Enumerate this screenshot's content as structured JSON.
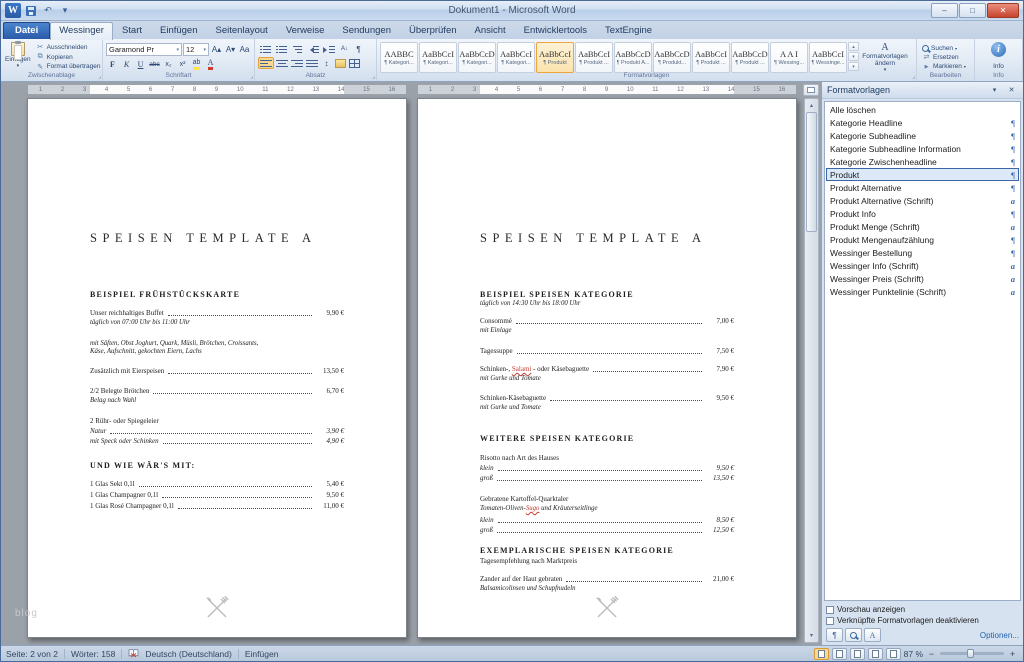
{
  "window": {
    "title": "Dokument1 - Microsoft Word"
  },
  "icons": {
    "undo": "↶",
    "caret_down": "▾",
    "caret_up": "▴",
    "minimize": "–",
    "maximize": "□",
    "close": "✕",
    "scissors": "✂",
    "copy": "⧉",
    "painter": "✎",
    "pilcrow": "¶",
    "sort": "A↓",
    "spacing": "↕",
    "grow": "A▴",
    "shrink": "A▾",
    "case": "Aa",
    "replace": "⇄",
    "select": "▶"
  },
  "tabs": {
    "file": "Datei",
    "items": [
      "Wessinger",
      "Start",
      "Einfügen",
      "Seitenlayout",
      "Verweise",
      "Sendungen",
      "Überprüfen",
      "Ansicht",
      "Entwicklertools",
      "TextEngine"
    ]
  },
  "ribbon": {
    "clipboard": {
      "group": "Zwischenablage",
      "paste": "Einfügen",
      "cut": "Ausschneiden",
      "copy": "Kopieren",
      "painter": "Format übertragen"
    },
    "font": {
      "group": "Schriftart",
      "name": "Garamond Pr",
      "size": "12",
      "bold": "F",
      "italic": "K",
      "underline": "U",
      "strike": "abc",
      "sub": "x₂",
      "sup": "x²",
      "highlight": "ab",
      "color": "A"
    },
    "paragraph": {
      "group": "Absatz"
    },
    "styles": {
      "group": "Formatvorlagen",
      "change": "Formatvorlagen ändern",
      "items": [
        {
          "preview": "AABBC",
          "name": "¶ Kategori..."
        },
        {
          "preview": "AaBbCcI",
          "name": "¶ Kategori..."
        },
        {
          "preview": "AaBbCcD",
          "name": "¶ Kategori..."
        },
        {
          "preview": "AaBbCcI",
          "name": "¶ Kategori..."
        },
        {
          "preview": "AaBbCcI",
          "name": "¶ Produkt"
        },
        {
          "preview": "AaBbCcI",
          "name": "¶ Produkt ..."
        },
        {
          "preview": "AaBbCcD",
          "name": "¶ Produkt A..."
        },
        {
          "preview": "AaBbCcD",
          "name": "¶ Produkt..."
        },
        {
          "preview": "AaBbCcI",
          "name": "¶ Produkt ..."
        },
        {
          "preview": "AaBbCcD",
          "name": "¶ Produkt ..."
        },
        {
          "preview": "A A I",
          "name": "¶ Wessing..."
        },
        {
          "preview": "AaBbCcI",
          "name": "¶ Wessinge..."
        }
      ]
    },
    "editing": {
      "group": "Bearbeiten",
      "find": "Suchen",
      "replace": "Ersetzen",
      "select": "Markieren"
    },
    "info": {
      "group": "Info",
      "label": "Info"
    }
  },
  "ruler": {
    "numbers": "1 2 3 4 5 6 7 8 9 10 11 12 13 14 15 16"
  },
  "doc": {
    "page1": {
      "title": "SPEISEN TEMPLATE A",
      "h1": "BEISPIEL FRÜHSTÜCKSKARTE",
      "i1": {
        "name": "Unser reichhaltiges Buffet",
        "price": "9,90 €",
        "sub": "täglich von 07:00 Uhr bis 11:00 Uhr"
      },
      "note1": "mit Säften, Obst Joghurt, Quark, Müsli, Brötchen, Croissants,",
      "note2": "Käse, Aufschnitt, gekochten Eiern, Lachs",
      "i2": {
        "name": "Zusätzlich mit Eierspeisen",
        "price": "13,50 €"
      },
      "i3": {
        "name": "2/2 Belegte Brötchen",
        "price": "6,70 €",
        "sub": "Belag nach Wahl"
      },
      "i4": {
        "name": "2 Rühr- oder Spiegeleier"
      },
      "i4a": {
        "name": "Natur",
        "price": "3,90 €"
      },
      "i4b": {
        "name": "mit Speck oder Schinken",
        "price": "4,90 €"
      },
      "h2": "UND WIE WÄR'S MIT:",
      "i5": {
        "name": "1 Glas Sekt  0,1l",
        "price": "5,40 €"
      },
      "i6": {
        "name": "1 Glas Champagner  0,1l",
        "price": "9,50 €"
      },
      "i7": {
        "name": "1 Glas Rosé Champagner  0,1l",
        "price": "11,00 €"
      }
    },
    "page2": {
      "title": "SPEISEN TEMPLATE A",
      "h1": "BEISPIEL SPEISEN KATEGORIE",
      "h1_sub": "täglich von 14:30 Uhr bis 18:00 Uhr",
      "i1": {
        "name": "Consommé",
        "price": "7,00 €",
        "sub": "mit Einlage"
      },
      "i2": {
        "name": "Tagessuppe",
        "price": "7,50 €"
      },
      "i3": {
        "pre": "Schinken-, ",
        "red": "Salami",
        "post": " - oder Käsebaguette",
        "price": "7,90 €",
        "sub": "mit Gurke und Tomate"
      },
      "i4": {
        "name": "Schinken-Käsebaguette",
        "price": "9,50 €",
        "sub": "mit Gurke und Tomate"
      },
      "h2": "WEITERE SPEISEN KATEGORIE",
      "i5": {
        "name": "Risotto nach Art des Hauses"
      },
      "i5a": {
        "name": "klein",
        "price": "9,50 €"
      },
      "i5b": {
        "name": "groß",
        "price": "13,50 €"
      },
      "i6": {
        "name": "Gebratene Kartoffel-Quarktaler"
      },
      "i6sub": {
        "pre": "Tomaten-Oliven-",
        "red": "Sugo",
        "post": " und Kräuterseitlinge"
      },
      "i6a": {
        "name": "klein",
        "price": "8,50 €"
      },
      "i6b": {
        "name": "groß",
        "price": "12,50 €"
      },
      "h3": "EXEMPLARISCHE SPEISEN KATEGORIE",
      "h3_sub": "Tagesempfehlung nach Marktpreis",
      "i7": {
        "name": "Zander auf der Haut gebraten",
        "price": "21,00 €",
        "sub": "Balsamicolinsen und Schupfnudeln"
      }
    }
  },
  "pane": {
    "title": "Formatvorlagen",
    "clear_all": "Alle löschen",
    "items": [
      {
        "label": "Kategorie Headline",
        "type": "¶"
      },
      {
        "label": "Kategorie Subheadline",
        "type": "¶"
      },
      {
        "label": "Kategorie Subheadline Information",
        "type": "¶"
      },
      {
        "label": "Kategorie Zwischenheadline",
        "type": "¶"
      },
      {
        "label": "Produkt",
        "type": "¶"
      },
      {
        "label": "Produkt Alternative",
        "type": "¶"
      },
      {
        "label": "Produkt Alternative (Schrift)",
        "type": "a"
      },
      {
        "label": "Produkt Info",
        "type": "¶"
      },
      {
        "label": "Produkt Menge (Schrift)",
        "type": "a"
      },
      {
        "label": "Produkt Mengenaufzählung",
        "type": "¶"
      },
      {
        "label": "Wessinger Bestellung",
        "type": "¶"
      },
      {
        "label": "Wessinger Info (Schrift)",
        "type": "a"
      },
      {
        "label": "Wessinger Preis (Schrift)",
        "type": "a"
      },
      {
        "label": "Wessinger Punktelinie (Schrift)",
        "type": "a"
      }
    ],
    "preview_label": "Vorschau anzeigen",
    "disable_linked_label": "Verknüpfte Formatvorlagen deaktivieren",
    "options": "Optionen..."
  },
  "status": {
    "page": "Seite: 2 von 2",
    "words": "Wörter: 158",
    "language": "Deutsch (Deutschland)",
    "mode": "Einfügen",
    "zoom": "87 %"
  },
  "watermark": "blog"
}
